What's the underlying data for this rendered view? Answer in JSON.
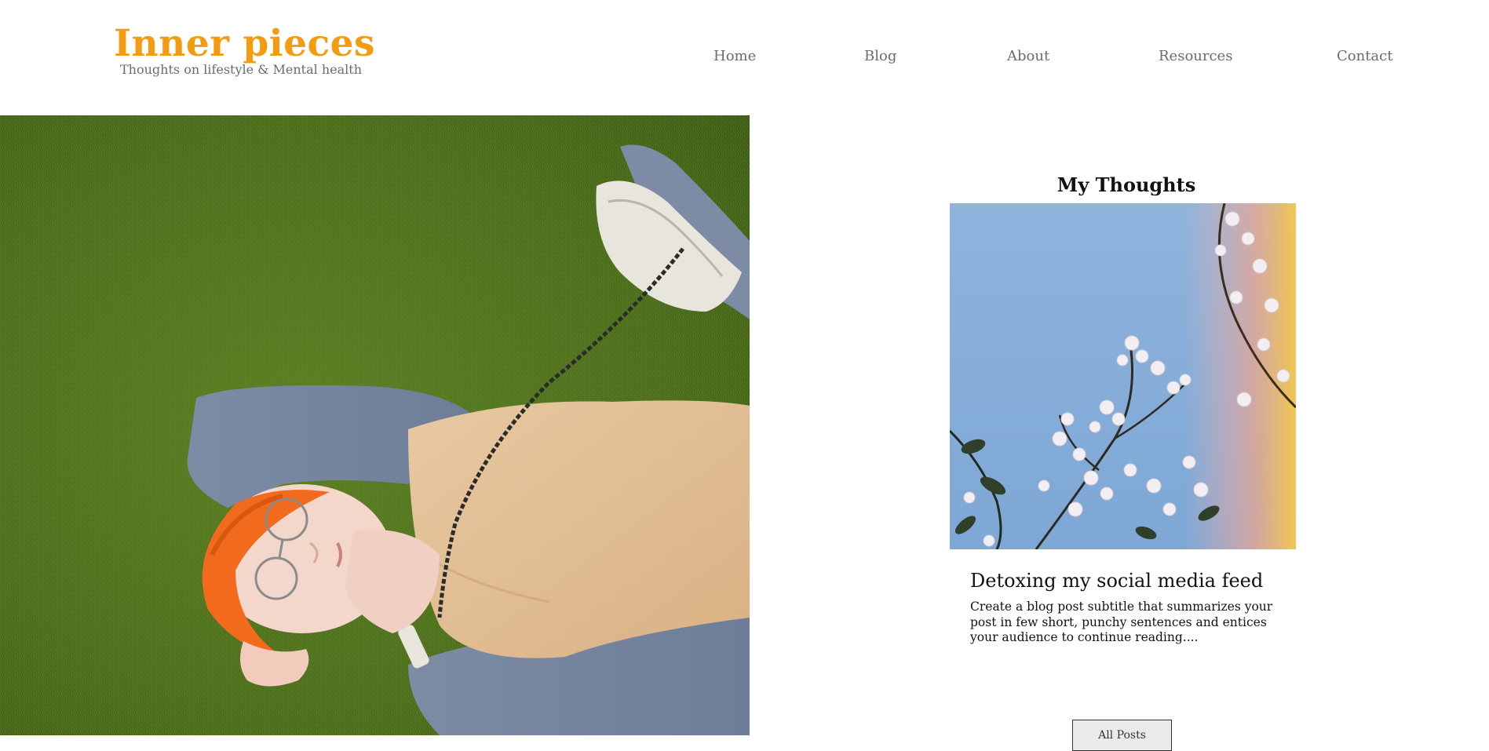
{
  "header": {
    "logo": "Inner pieces",
    "tagline": "Thoughts on lifestyle & Mental health",
    "accent_color": "#f39c12"
  },
  "nav": {
    "items": [
      {
        "label": "Home"
      },
      {
        "label": "Blog"
      },
      {
        "label": "About"
      },
      {
        "label": "Resources"
      },
      {
        "label": "Contact"
      }
    ]
  },
  "hero": {
    "image": "woman-lying-on-grass-photo"
  },
  "blog_section": {
    "title": "My Thoughts",
    "post": {
      "image": "blossom-branches-sky-photo",
      "title": "Detoxing my social media feed",
      "excerpt": "Create a blog post subtitle that summarizes your post in few short, punchy sentences and entices your audience to continue reading...."
    },
    "button_label": "All Posts"
  }
}
